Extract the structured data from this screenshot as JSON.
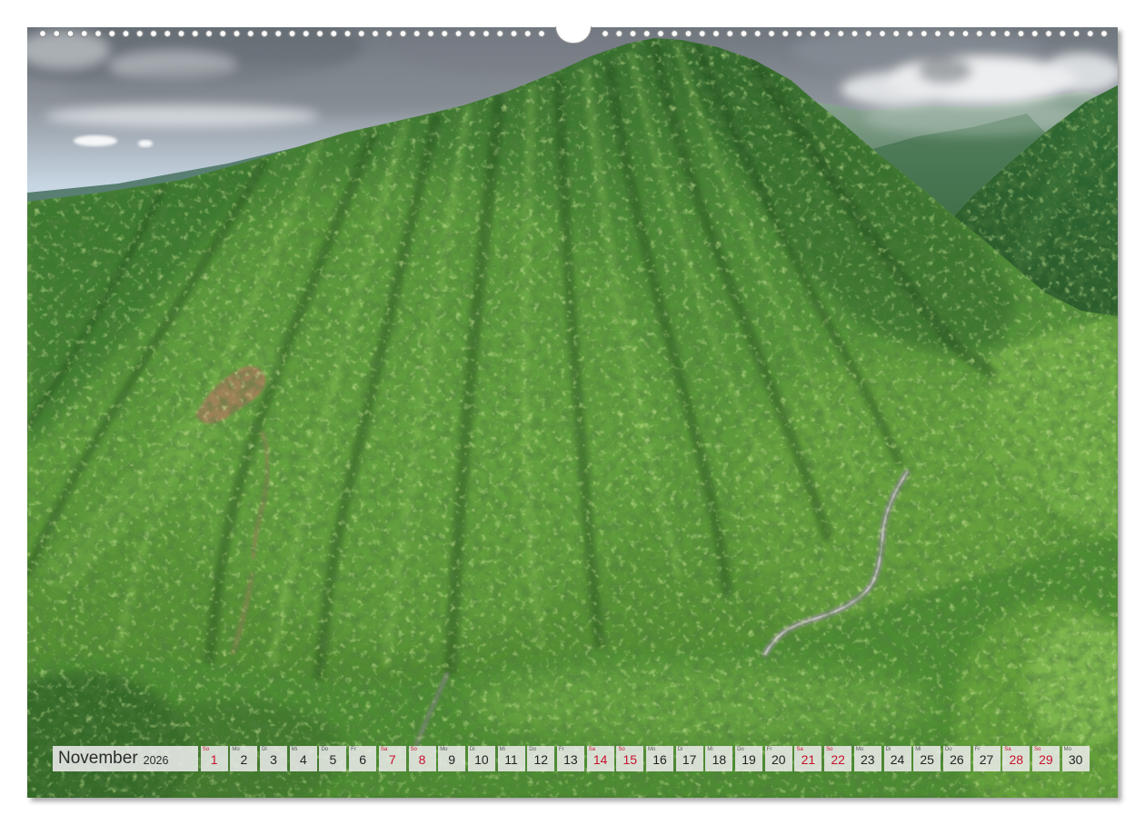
{
  "calendar": {
    "month": "November",
    "year": "2026",
    "weekend_color": "#c8102e",
    "days": [
      {
        "weekday": "So",
        "day": "1",
        "weekend": true
      },
      {
        "weekday": "Mo",
        "day": "2",
        "weekend": false
      },
      {
        "weekday": "Di",
        "day": "3",
        "weekend": false
      },
      {
        "weekday": "Mi",
        "day": "4",
        "weekend": false
      },
      {
        "weekday": "Do",
        "day": "5",
        "weekend": false
      },
      {
        "weekday": "Fr",
        "day": "6",
        "weekend": false
      },
      {
        "weekday": "Sa",
        "day": "7",
        "weekend": true
      },
      {
        "weekday": "So",
        "day": "8",
        "weekend": true
      },
      {
        "weekday": "Mo",
        "day": "9",
        "weekend": false
      },
      {
        "weekday": "Di",
        "day": "10",
        "weekend": false
      },
      {
        "weekday": "Mi",
        "day": "11",
        "weekend": false
      },
      {
        "weekday": "Do",
        "day": "12",
        "weekend": false
      },
      {
        "weekday": "Fr",
        "day": "13",
        "weekend": false
      },
      {
        "weekday": "Sa",
        "day": "14",
        "weekend": true
      },
      {
        "weekday": "So",
        "day": "15",
        "weekend": true
      },
      {
        "weekday": "Mo",
        "day": "16",
        "weekend": false
      },
      {
        "weekday": "Di",
        "day": "17",
        "weekend": false
      },
      {
        "weekday": "Mi",
        "day": "18",
        "weekend": false
      },
      {
        "weekday": "Do",
        "day": "19",
        "weekend": false
      },
      {
        "weekday": "Fr",
        "day": "20",
        "weekend": false
      },
      {
        "weekday": "Sa",
        "day": "21",
        "weekend": true
      },
      {
        "weekday": "So",
        "day": "22",
        "weekend": true
      },
      {
        "weekday": "Mo",
        "day": "23",
        "weekend": false
      },
      {
        "weekday": "Di",
        "day": "24",
        "weekend": false
      },
      {
        "weekday": "Mi",
        "day": "25",
        "weekend": false
      },
      {
        "weekday": "Do",
        "day": "26",
        "weekend": false
      },
      {
        "weekday": "Fr",
        "day": "27",
        "weekend": false
      },
      {
        "weekday": "Sa",
        "day": "28",
        "weekend": true
      },
      {
        "weekday": "So",
        "day": "29",
        "weekend": true
      },
      {
        "weekday": "Mo",
        "day": "30",
        "weekend": false
      }
    ]
  }
}
